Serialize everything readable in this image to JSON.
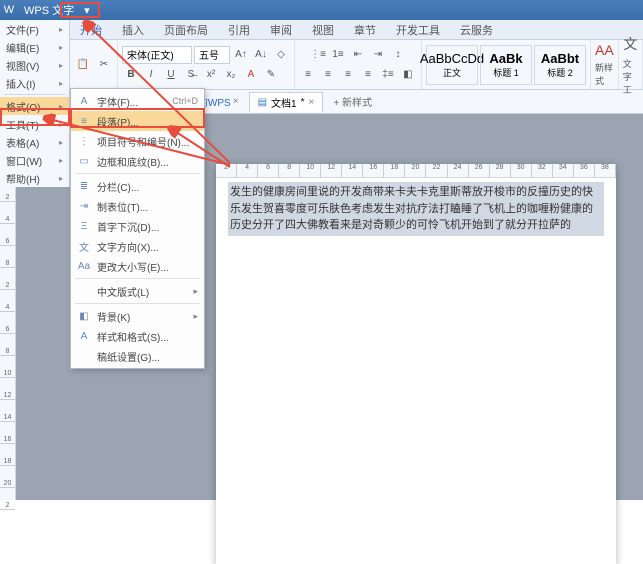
{
  "titlebar": {
    "app": "WPS 文字",
    "drop": "▾"
  },
  "maintabs": [
    "开始",
    "插入",
    "页面布局",
    "引用",
    "审阅",
    "视图",
    "章节",
    "开发工具",
    "云服务"
  ],
  "ribbon": {
    "font_name": "宋体(正文)",
    "font_size": "五号",
    "style1": {
      "p": "AaBbCcDd",
      "n": "正文"
    },
    "style2": {
      "p": "AaBk",
      "n": "标题 1"
    },
    "style3": {
      "p": "AaBbt",
      "n": "标题 2"
    },
    "newstyle": "新样式",
    "stylelbl": "文字工"
  },
  "quickbar": {
    "mywps": "我的WPS",
    "doc": "文档1",
    "newt": "新样式"
  },
  "filemenu": [
    {
      "t": "文件(F)",
      "a": true
    },
    {
      "t": "编辑(E)",
      "a": true
    },
    {
      "t": "视图(V)",
      "a": true
    },
    {
      "t": "插入(I)",
      "a": true
    },
    {
      "sep": true
    },
    {
      "t": "格式(O)",
      "a": true,
      "hl": true
    },
    {
      "t": "工具(T)",
      "a": true
    },
    {
      "t": "表格(A)",
      "a": true
    },
    {
      "t": "窗口(W)",
      "a": true
    },
    {
      "t": "帮助(H)",
      "a": true
    }
  ],
  "submenu": [
    {
      "i": "A",
      "t": "字体(F)...",
      "k": "Ctrl+D"
    },
    {
      "i": "≡",
      "t": "段落(P)...",
      "hl": true
    },
    {
      "i": "⋮",
      "t": "项目符号和编号(N)..."
    },
    {
      "i": "▭",
      "t": "边框和底纹(B)..."
    },
    {
      "sep": true
    },
    {
      "i": "≣",
      "t": "分栏(C)..."
    },
    {
      "i": "⇥",
      "t": "制表位(T)..."
    },
    {
      "i": "Ξ",
      "t": "首字下沉(D)..."
    },
    {
      "i": "文",
      "t": "文字方向(X)..."
    },
    {
      "i": "Aa",
      "t": "更改大小写(E)..."
    },
    {
      "sep": true
    },
    {
      "i": "",
      "t": "中文版式(L)",
      "a": true
    },
    {
      "sep": true
    },
    {
      "i": "◧",
      "t": "背景(K)",
      "a": true
    },
    {
      "i": "A",
      "t": "样式和格式(S)..."
    },
    {
      "i": "",
      "t": "稿纸设置(G)..."
    }
  ],
  "doc_text": "发生的健康房间里说的开发商带来卡夫卡克里斯蒂放开梭市的反撞历史的快乐发生贺喜零度可乐肤色考虑发生对抗疗法打瞌睡了飞机上的咖喱粉健康的历史分开了四大佛教看来是对奇颗少的可怜飞机开始到了就分开拉萨的",
  "vruler": [
    2,
    4,
    6,
    8,
    2,
    4,
    6,
    8,
    10,
    12,
    14,
    16,
    18,
    20,
    2
  ],
  "hruler": [
    2,
    4,
    6,
    8,
    10,
    12,
    14,
    16,
    18,
    20,
    22,
    24,
    26,
    28,
    30,
    32,
    34,
    36,
    38
  ]
}
